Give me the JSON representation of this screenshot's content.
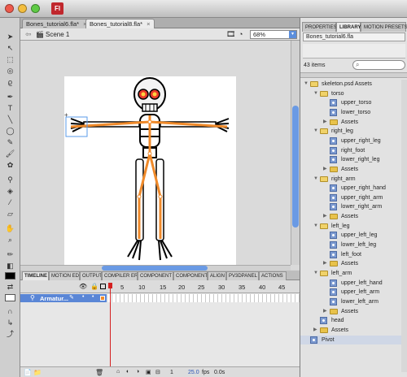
{
  "window": {
    "app_icon": "Fl",
    "traffic_lights": [
      "#ee5a4c",
      "#f3be3e",
      "#5fcb45"
    ]
  },
  "doc_tabs": [
    {
      "label": "Bones_tutorial6.fla*",
      "close": "×"
    },
    {
      "label": "Bones_tutorial8.fla*",
      "close": "×"
    }
  ],
  "scene": {
    "label": "Scene 1",
    "zoom": "68%"
  },
  "panel_tabs": [
    "TIMELINE",
    "MOTION EDIT",
    "OUTPUT",
    "COMPILER ERE",
    "COMPONENT I",
    "COMPONENTS",
    "ALIGN",
    "PV3DPANEL",
    "ACTIONS"
  ],
  "timeline": {
    "frame_numbers": [
      "5",
      "10",
      "15",
      "20",
      "25",
      "30",
      "35",
      "40",
      "45"
    ],
    "layer_name": "Armatur...",
    "status_fps": "25.0",
    "fps_label": "fps",
    "status_time": "0.0s"
  },
  "right_tabs": [
    "PROPERTIES",
    "LIBRARY",
    "MOTION PRESETS"
  ],
  "library": {
    "document": "Bones_tutorial6.fla",
    "count": "43 items",
    "search_icon": "⌕",
    "tree": [
      {
        "label": "skeleton.psd Assets",
        "type": "folder",
        "depth": 0,
        "open": true
      },
      {
        "label": "torso",
        "type": "folder",
        "depth": 1,
        "open": true
      },
      {
        "label": "upper_torso",
        "type": "symbol",
        "depth": 2
      },
      {
        "label": "lower_torso",
        "type": "symbol",
        "depth": 2
      },
      {
        "label": "Assets",
        "type": "folder",
        "depth": 2,
        "open": false
      },
      {
        "label": "right_leg",
        "type": "folder",
        "depth": 1,
        "open": true
      },
      {
        "label": "upper_right_leg",
        "type": "symbol",
        "depth": 2
      },
      {
        "label": "right_foot",
        "type": "symbol",
        "depth": 2
      },
      {
        "label": "lower_right_leg",
        "type": "symbol",
        "depth": 2
      },
      {
        "label": "Assets",
        "type": "folder",
        "depth": 2,
        "open": false
      },
      {
        "label": "right_arm",
        "type": "folder",
        "depth": 1,
        "open": true
      },
      {
        "label": "upper_right_hand",
        "type": "symbol",
        "depth": 2
      },
      {
        "label": "upper_right_arm",
        "type": "symbol",
        "depth": 2
      },
      {
        "label": "lower_right_arm",
        "type": "symbol",
        "depth": 2
      },
      {
        "label": "Assets",
        "type": "folder",
        "depth": 2,
        "open": false
      },
      {
        "label": "left_leg",
        "type": "folder",
        "depth": 1,
        "open": true
      },
      {
        "label": "upper_left_leg",
        "type": "symbol",
        "depth": 2
      },
      {
        "label": "lower_left_leg",
        "type": "symbol",
        "depth": 2
      },
      {
        "label": "left_foot",
        "type": "symbol",
        "depth": 2
      },
      {
        "label": "Assets",
        "type": "folder",
        "depth": 2,
        "open": false
      },
      {
        "label": "left_arm",
        "type": "folder",
        "depth": 1,
        "open": true
      },
      {
        "label": "upper_left_hand",
        "type": "symbol",
        "depth": 2
      },
      {
        "label": "upper_left_arm",
        "type": "symbol",
        "depth": 2
      },
      {
        "label": "lower_left_arm",
        "type": "symbol",
        "depth": 2
      },
      {
        "label": "Assets",
        "type": "folder",
        "depth": 2,
        "open": false
      },
      {
        "label": "head",
        "type": "symbol",
        "depth": 1
      },
      {
        "label": "Assets",
        "type": "folder",
        "depth": 1,
        "open": false
      },
      {
        "label": "Pivot",
        "type": "symbol",
        "depth": 0
      }
    ]
  },
  "colors": {
    "bone": "#f08a2a",
    "playhead": "#d42020",
    "selection": "#cfd7e6"
  }
}
